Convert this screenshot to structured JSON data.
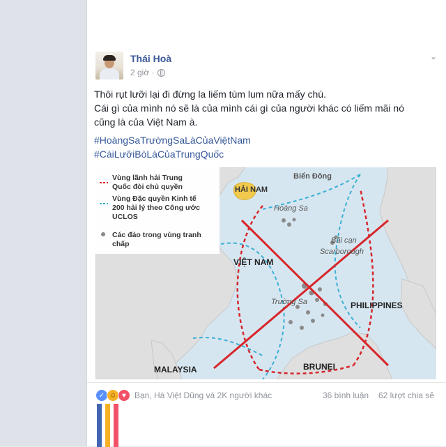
{
  "post": {
    "author": "Thái Hoà",
    "time": "2 giờ ·",
    "body_line1": "Thôi rụt lưỡi lại đi đừng la liếm tùm lum nữa mấy chú.",
    "body_line2": "Cái gì của mình nó sẽ là của mình cái gì của người khác có liếm mãi nó",
    "body_line3": "cũng là của Việt Nam à.",
    "hashtag1": "#HoàngSaTrườngSaLàCủaViệtNam",
    "hashtag2": "#CáiLưỡiBòLàCủaTrungQuốc"
  },
  "map": {
    "legend": {
      "item1_line1": "Vùng lãnh hải Trung",
      "item1_line2": "Quốc đòi chủ quyền",
      "item2_line1": "Vùng Đặc quyền Kinh tế",
      "item2_line2": "200 hải lý theo Công ước",
      "item2_line3": "UCLOS",
      "item3_line1": "Các đảo trong vùng tranh",
      "item3_line2": "chấp"
    },
    "labels": {
      "bien_dong": "Biển Đông",
      "hai_nam": "HẢI NAM",
      "hoang_sa": "Hoàng Sa",
      "bai_can_1": "Bãi cạn",
      "bai_can_2": "Scarborough",
      "viet_nam": "VIỆT NAM",
      "truong_sa": "Trường Sa",
      "philippines": "PHILIPPINES",
      "malaysia": "MALAYSIA",
      "brunei": "BRUNEI"
    },
    "colors": {
      "sea": "#d6e6f0",
      "land": "#dfdfdf",
      "claim": "#d7262b",
      "eez": "#3bb0d4",
      "cross": "#d7262b",
      "hainan": "#f1c94c"
    }
  },
  "footer": {
    "reactions_text": "Bạn, Hà Việt Dũng và 2K người khác",
    "comments": "36 bình luận",
    "shares": "62 lượt chia sẻ",
    "reaction_icons": [
      "like-icon",
      "haha-icon",
      "love-icon"
    ],
    "stripe_colors": [
      "#4267b2",
      "#f7b125",
      "#f25268"
    ]
  }
}
